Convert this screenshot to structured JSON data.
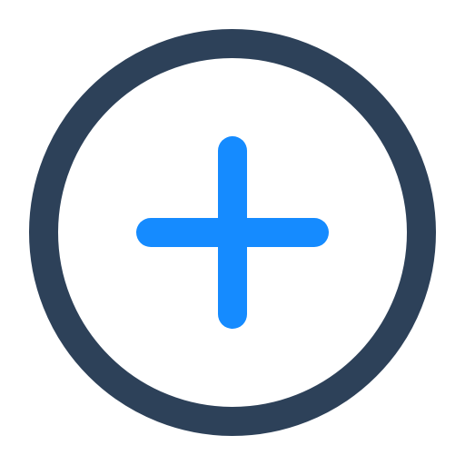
{
  "icon": {
    "name": "add-circle-icon",
    "ring_color": "#2D4159",
    "plus_color": "#158BFF",
    "background_color": "#FFFFFF"
  }
}
